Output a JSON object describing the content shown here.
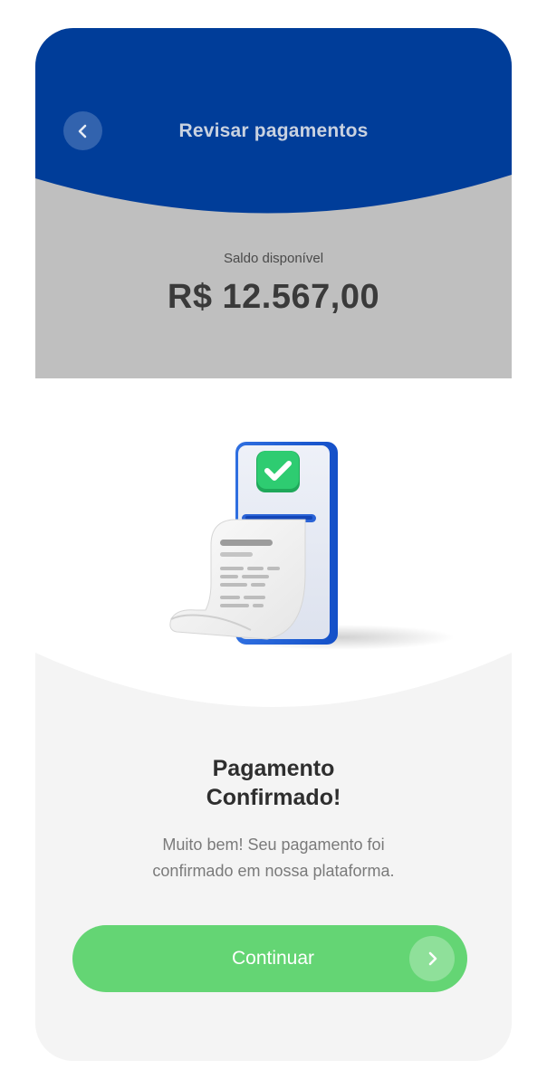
{
  "header": {
    "title": "Revisar pagamentos",
    "back_icon": "chevron-left-icon"
  },
  "balance": {
    "label": "Saldo disponível",
    "value": "R$ 12.567,00"
  },
  "illustration": {
    "icon": "phone-receipt-check-icon"
  },
  "confirmation": {
    "title_line1": "Pagamento",
    "title_line2": "Confirmado!",
    "message_line1": "Muito bem! Seu pagamento foi",
    "message_line2": "confirmado em nossa plataforma."
  },
  "continue_button": {
    "label": "Continuar",
    "icon": "chevron-right-icon"
  },
  "colors": {
    "header_blue": "#003d99",
    "balance_gray": "#bfbfbf",
    "accent_green": "#64d574",
    "content_bg": "#f4f4f4"
  }
}
